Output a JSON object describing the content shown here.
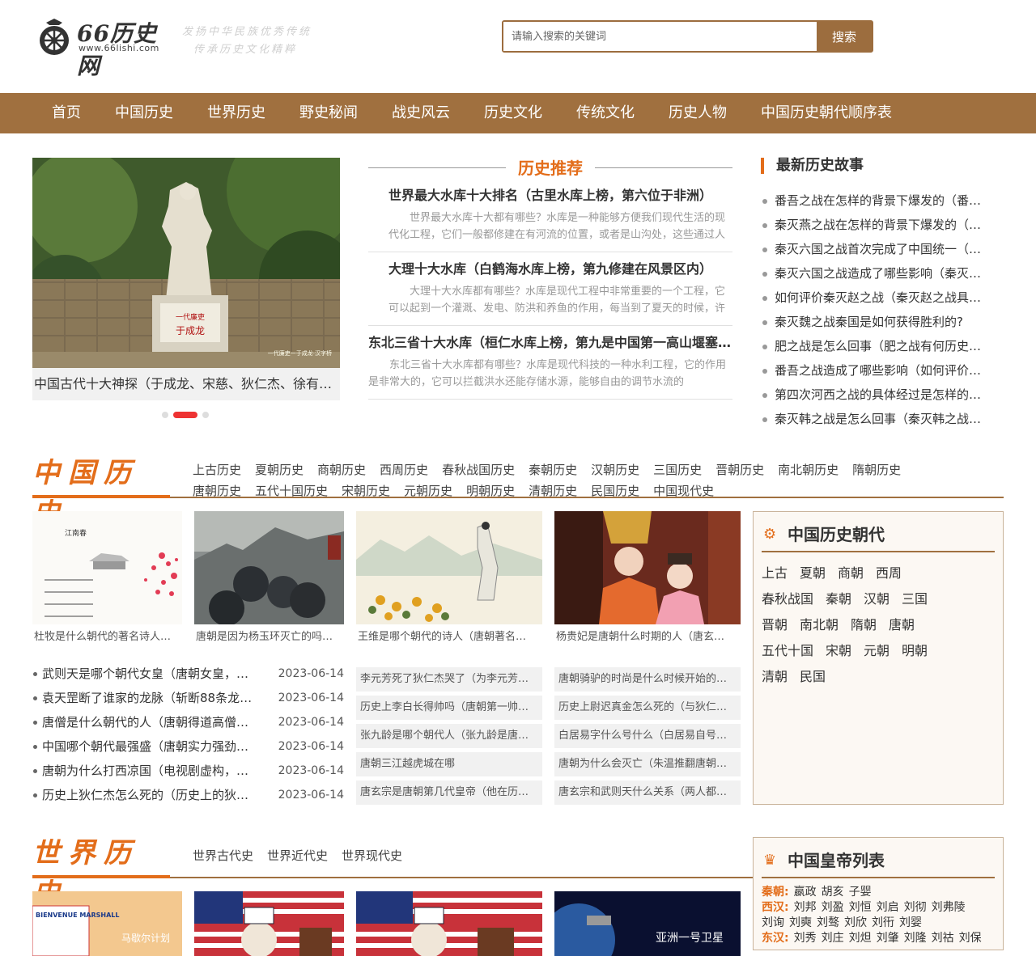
{
  "header": {
    "logo_text": "66历史网",
    "logo_url": "www.66lishi.com",
    "slogan_line1": "发扬中华民族优秀传统",
    "slogan_line2": "传承历史文化精粹",
    "search_placeholder": "请输入搜索的关键词",
    "search_button": "搜索"
  },
  "nav": [
    "首页",
    "中国历史",
    "世界历史",
    "野史秘闻",
    "战史风云",
    "历史文化",
    "传统文化",
    "历史人物",
    "中国历史朝代顺序表"
  ],
  "slider": {
    "caption": "中国古代十大神探（于成龙、宋慈、狄仁杰、徐有…",
    "statue_label": "于成龙",
    "corner_text": "一代廉吏一于成龙·汉字桥"
  },
  "recommend": {
    "title": "历史推荐",
    "items": [
      {
        "title": "世界最大水库十大排名（古里水库上榜，第六位于非洲）",
        "desc": "世界最大水库十大都有哪些？水库是一种能够方便我们现代生活的现代化工程，它们一般都修建在有河流的位置，或者是山沟处，这些通过人"
      },
      {
        "title": "大理十大水库（白鹤海水库上榜，第九修建在风景区内）",
        "desc": "大理十大水库都有哪些？水库是现代工程中非常重要的一个工程，它可以起到一个灌溉、发电、防洪和养鱼的作用，每当到了夏天的时候，许"
      },
      {
        "title": "东北三省十大水库（桓仁水库上榜，第九是中国第一高山堰塞…",
        "desc": "东北三省十大水库都有哪些？水库是现代科技的一种水利工程，它的作用是非常大的，它可以拦截洪水还能存储水源，能够自由的调节水流的"
      }
    ]
  },
  "latest": {
    "title": "最新历史故事",
    "items": [
      "番吾之战在怎样的背景下爆发的（番…",
      "秦灭燕之战在怎样的背景下爆发的（…",
      "秦灭六国之战首次完成了中国统一（…",
      "秦灭六国之战造成了哪些影响（秦灭…",
      "如何评价秦灭赵之战（秦灭赵之战具…",
      "秦灭魏之战秦国是如何获得胜利的?",
      "肥之战是怎么回事（肥之战有何历史…",
      "番吾之战造成了哪些影响（如何评价…",
      "第四次河西之战的具体经过是怎样的…",
      "秦灭韩之战是怎么回事（秦灭韩之战…"
    ]
  },
  "china": {
    "title": "中国历史",
    "links": [
      "上古历史",
      "夏朝历史",
      "商朝历史",
      "西周历史",
      "春秋战国历史",
      "秦朝历史",
      "汉朝历史",
      "三国历史",
      "晋朝历史",
      "南北朝历史",
      "隋朝历史",
      "唐朝历史",
      "五代十国历史",
      "宋朝历史",
      "元朝历史",
      "明朝历史",
      "清朝历史",
      "民国历史",
      "中国现代史"
    ],
    "thumbs": [
      {
        "caption": "杜牧是什么朝代的著名诗人…",
        "poem": "江南春"
      },
      {
        "caption": "唐朝是因为杨玉环灭亡的吗…"
      },
      {
        "caption": "王维是哪个朝代的诗人（唐朝著名…"
      },
      {
        "caption": "杨贵妃是唐朝什么时期的人（唐玄…"
      }
    ],
    "list": [
      {
        "title": "武则天是哪个朝代女皇（唐朝女皇，…",
        "date": "2023-06-14"
      },
      {
        "title": "袁天罡断了谁家的龙脉（斩断88条龙…",
        "date": "2023-06-14"
      },
      {
        "title": "唐僧是什么朝代的人（唐朝得道高僧…",
        "date": "2023-06-14"
      },
      {
        "title": "中国哪个朝代最强盛（唐朝实力强劲…",
        "date": "2023-06-14"
      },
      {
        "title": "唐朝为什么打西凉国（电视剧虚构，…",
        "date": "2023-06-14"
      },
      {
        "title": "历史上狄仁杰怎么死的（历史上的狄…",
        "date": "2023-06-14"
      }
    ],
    "gray1": [
      "李元芳死了狄仁杰哭了（为李元芳…",
      "历史上李白长得帅吗（唐朝第一帅…",
      "张九龄是哪个朝代人（张九龄是唐…",
      "唐朝三江越虎城在哪",
      "唐玄宗是唐朝第几代皇帝（他在历…"
    ],
    "gray2": [
      "唐朝骑驴的时尚是什么时候开始的…",
      "历史上尉迟真金怎么死的（与狄仁…",
      "白居易字什么号什么（白居易自号…",
      "唐朝为什么会灭亡（朱温推翻唐朝…",
      "唐玄宗和武则天什么关系（两人都…"
    ]
  },
  "dynasties": {
    "title": "中国历史朝代",
    "items": [
      "上古",
      "夏朝",
      "商朝",
      "西周",
      "春秋战国",
      "秦朝",
      "汉朝",
      "三国",
      "晋朝",
      "南北朝",
      "隋朝",
      "唐朝",
      "五代十国",
      "宋朝",
      "元朝",
      "明朝",
      "清朝",
      "民国"
    ]
  },
  "world": {
    "title": "世界历史",
    "links": [
      "世界古代史",
      "世界近代史",
      "世界现代史"
    ],
    "thumbs": [
      {
        "caption": "马歇尔计划",
        "poster": "BIENVENUE MARSHALL"
      },
      {
        "caption": ""
      },
      {
        "caption": ""
      },
      {
        "caption": "亚洲一号卫星"
      }
    ]
  },
  "emperors": {
    "title": "中国皇帝列表",
    "rows": [
      {
        "dyn": "秦朝:",
        "names": [
          "嬴政",
          "胡亥",
          "子婴"
        ]
      },
      {
        "dyn": "西汉:",
        "names": [
          "刘邦",
          "刘盈",
          "刘恒",
          "刘启",
          "刘彻",
          "刘弗陵"
        ]
      },
      {
        "dyn": "",
        "names": [
          "刘询",
          "刘奭",
          "刘骜",
          "刘欣",
          "刘衎",
          "刘婴"
        ]
      },
      {
        "dyn": "东汉:",
        "names": [
          "刘秀",
          "刘庄",
          "刘炟",
          "刘肇",
          "刘隆",
          "刘祜",
          "刘保"
        ]
      }
    ]
  },
  "colors": {
    "brand": "#a0703f",
    "accent": "#e36d1a",
    "active_dot": "#e33333"
  }
}
